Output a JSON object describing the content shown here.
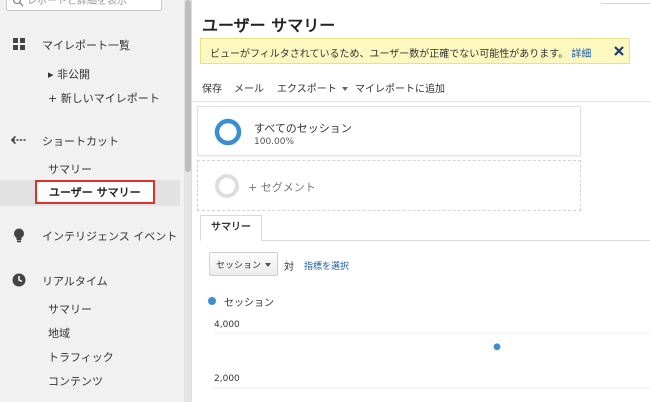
{
  "search": {
    "placeholder": "レポートと詳細を表示"
  },
  "sidebar": {
    "sections": [
      {
        "label": "マイレポート一覧",
        "icon": "grid-icon"
      },
      {
        "label": "ショートカット",
        "icon": "shortcut-arrow-icon"
      },
      {
        "label": "インテリジェンス イベント",
        "icon": "lightbulb-icon"
      },
      {
        "label": "リアルタイム",
        "icon": "clock-icon"
      }
    ],
    "my_reports_items": [
      "▸ 非公開",
      "+ 新しいマイレポート"
    ],
    "shortcut_items": [
      "サマリー",
      "ユーザー サマリー"
    ],
    "realtime_items": [
      "サマリー",
      "地域",
      "トラフィック",
      "コンテンツ"
    ]
  },
  "header": {
    "title": "ユーザー サマリー"
  },
  "notice": {
    "text": "ビューがフィルタされているため、ユーザー数が正確でない可能性があります。",
    "link": "詳細"
  },
  "toolbar": {
    "save": "保存",
    "email": "メール",
    "export": "エクスポート",
    "add_to_dashboard": "マイレポートに追加"
  },
  "segments": {
    "active": {
      "name": "すべてのセッション",
      "percent": "100.00%"
    },
    "add_label": "+ セグメント"
  },
  "tabs": [
    "サマリー"
  ],
  "metric": {
    "selected": "セッション",
    "vs": "対",
    "choose": "指標を選択"
  },
  "colors": {
    "accent": "#3b8fd1",
    "notice_bg": "#fcf8bf",
    "highlight_border": "#e0302b",
    "link": "#1a5ea8"
  },
  "chart_data": {
    "type": "line",
    "series": [
      {
        "name": "セッション",
        "values": [
          3500
        ]
      }
    ],
    "y_ticks": [
      "4,000",
      "2,000"
    ],
    "ylim": [
      0,
      4000
    ]
  }
}
